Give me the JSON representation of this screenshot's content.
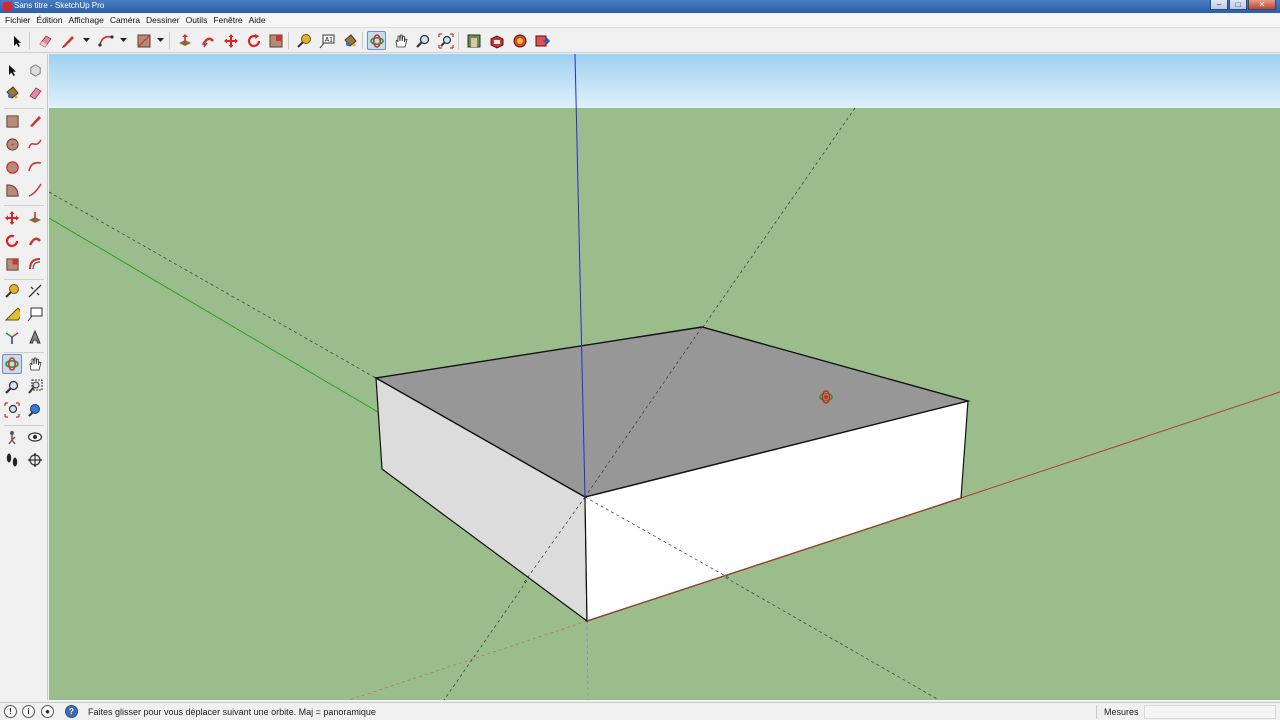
{
  "window": {
    "title": "Sans titre - SketchUp Pro",
    "controls": [
      "minimize",
      "maximize",
      "close"
    ]
  },
  "menu": {
    "items": [
      "Fichier",
      "Édition",
      "Affichage",
      "Caméra",
      "Dessiner",
      "Outils",
      "Fenêtre",
      "Aide"
    ]
  },
  "toolbar": {
    "tools": [
      "select-tool",
      "eraser-tool",
      "line-tool",
      "arc-tool",
      "rectangle-tool",
      "push-pull-tool",
      "follow-me-tool",
      "move-tool",
      "rotate-tool",
      "scale-tool",
      "tape-measure-tool",
      "text-tool",
      "paint-bucket-tool",
      "orbit-tool",
      "pan-tool",
      "zoom-tool",
      "zoom-extents-tool",
      "warehouse-tool",
      "extension-warehouse-tool",
      "share-model-tool",
      "send-to-layout-tool"
    ],
    "active_tool": "orbit-tool"
  },
  "left_toolbar": {
    "active_tool": "orbit-tool"
  },
  "viewport": {
    "sky_color": "#bfe3f5",
    "ground_color": "#9bbd8c",
    "top_face_color": "#979797",
    "front_face_color": "#ffffff",
    "side_face_color": "#dcdcdc",
    "axis_colors": {
      "red": "#b23a2a",
      "green": "#2aa02a",
      "blue": "#2a2ad8"
    }
  },
  "status": {
    "icons": [
      "geo-location-icon",
      "credits-icon",
      "user-icon",
      "help-icon"
    ],
    "hint": "Faites glisser pour vous déplacer suivant une orbite.  Maj = panoramique",
    "measure_label": "Mesures",
    "measure_value": ""
  }
}
